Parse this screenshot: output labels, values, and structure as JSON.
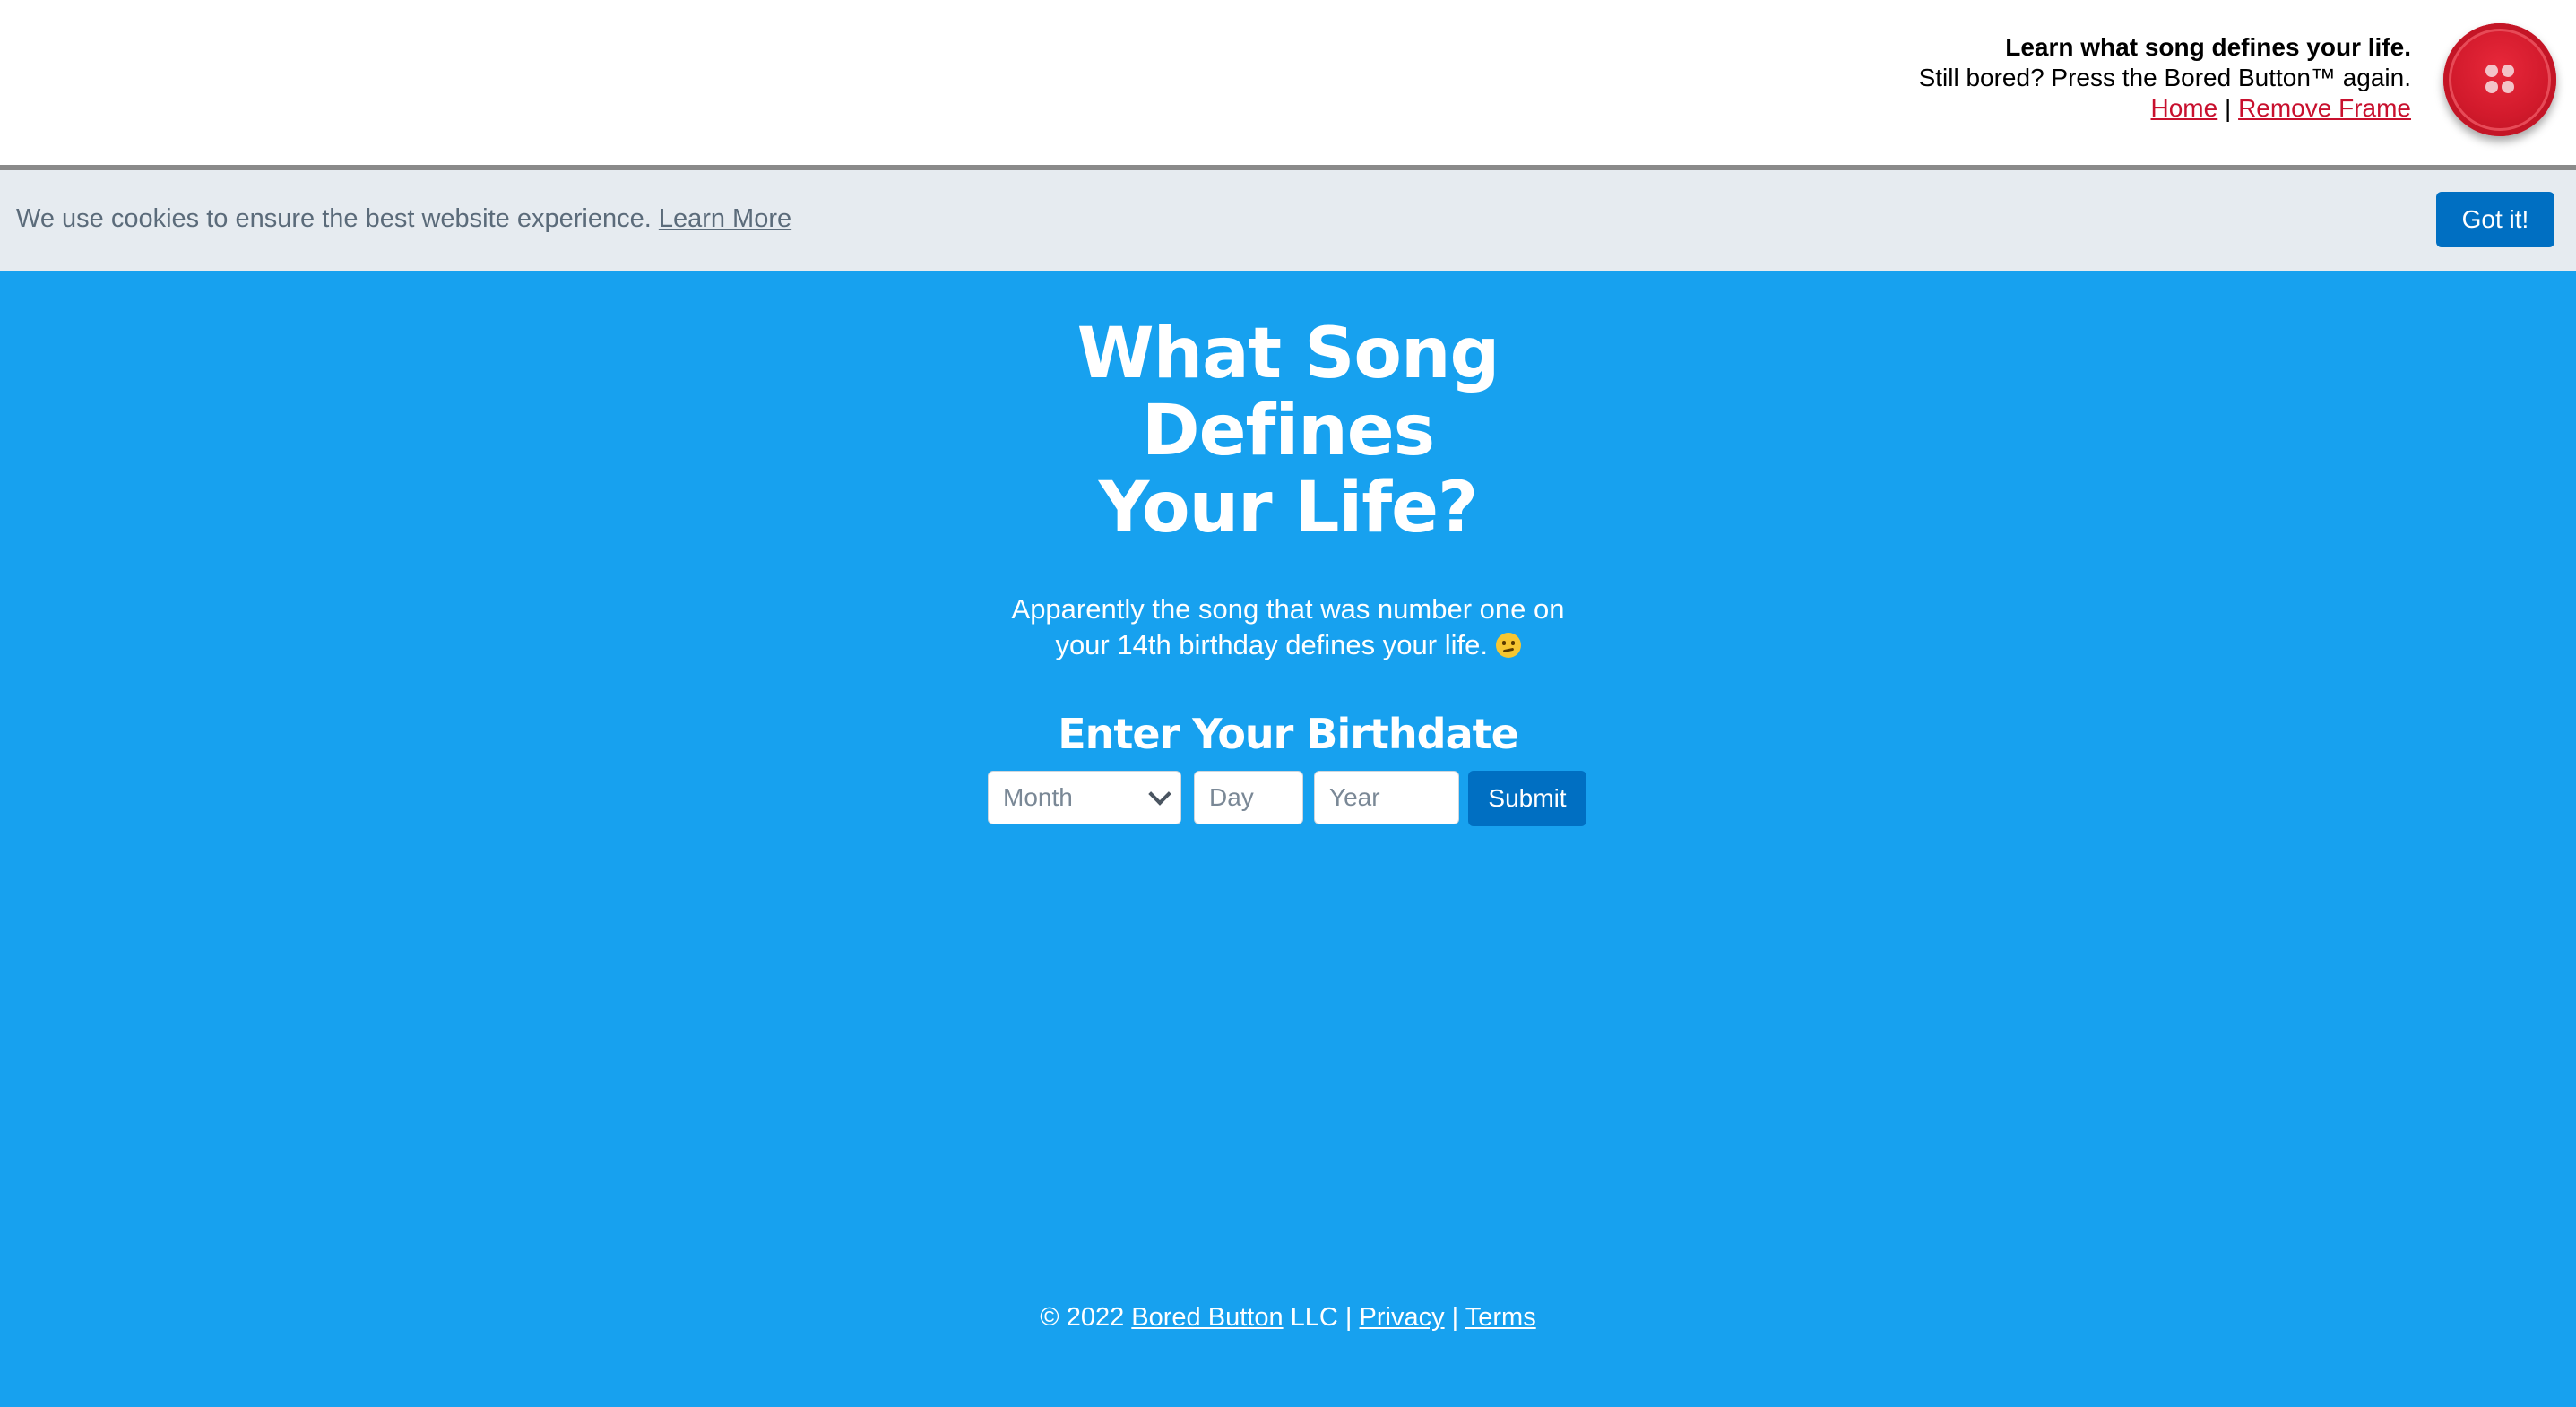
{
  "topbar": {
    "headline": "Learn what song defines your life.",
    "tagline": "Still bored? Press the Bored Button™ again.",
    "home_link": "Home",
    "separator": "|",
    "remove_frame_link": "Remove Frame",
    "button_icon": "bored-button-icon"
  },
  "cookie": {
    "message": "We use cookies to ensure the best website experience.",
    "learn_more": "Learn More",
    "accept": "Got it!"
  },
  "main": {
    "title_line1": "What Song Defines",
    "title_line2": "Your Life?",
    "subtitle_line1": "Apparently the song that was number one on",
    "subtitle_line2": "your 14th birthday defines your life.",
    "subtitle_emoji": "thinking-face-icon",
    "form_title": "Enter Your Birthdate",
    "month_selected": "Month",
    "day_placeholder": "Day",
    "year_placeholder": "Year",
    "submit_label": "Submit"
  },
  "footer": {
    "copyright": "© 2022",
    "company_link": "Bored Button",
    "company_suffix": "LLC |",
    "privacy_link": "Privacy",
    "separator": "|",
    "terms_link": "Terms"
  },
  "colors": {
    "background": "#17a1ef",
    "button_blue": "#006fc2",
    "link_red": "#c8102e",
    "bored_button_red": "#d21a2c",
    "cookie_bar": "#e6ebf0"
  }
}
